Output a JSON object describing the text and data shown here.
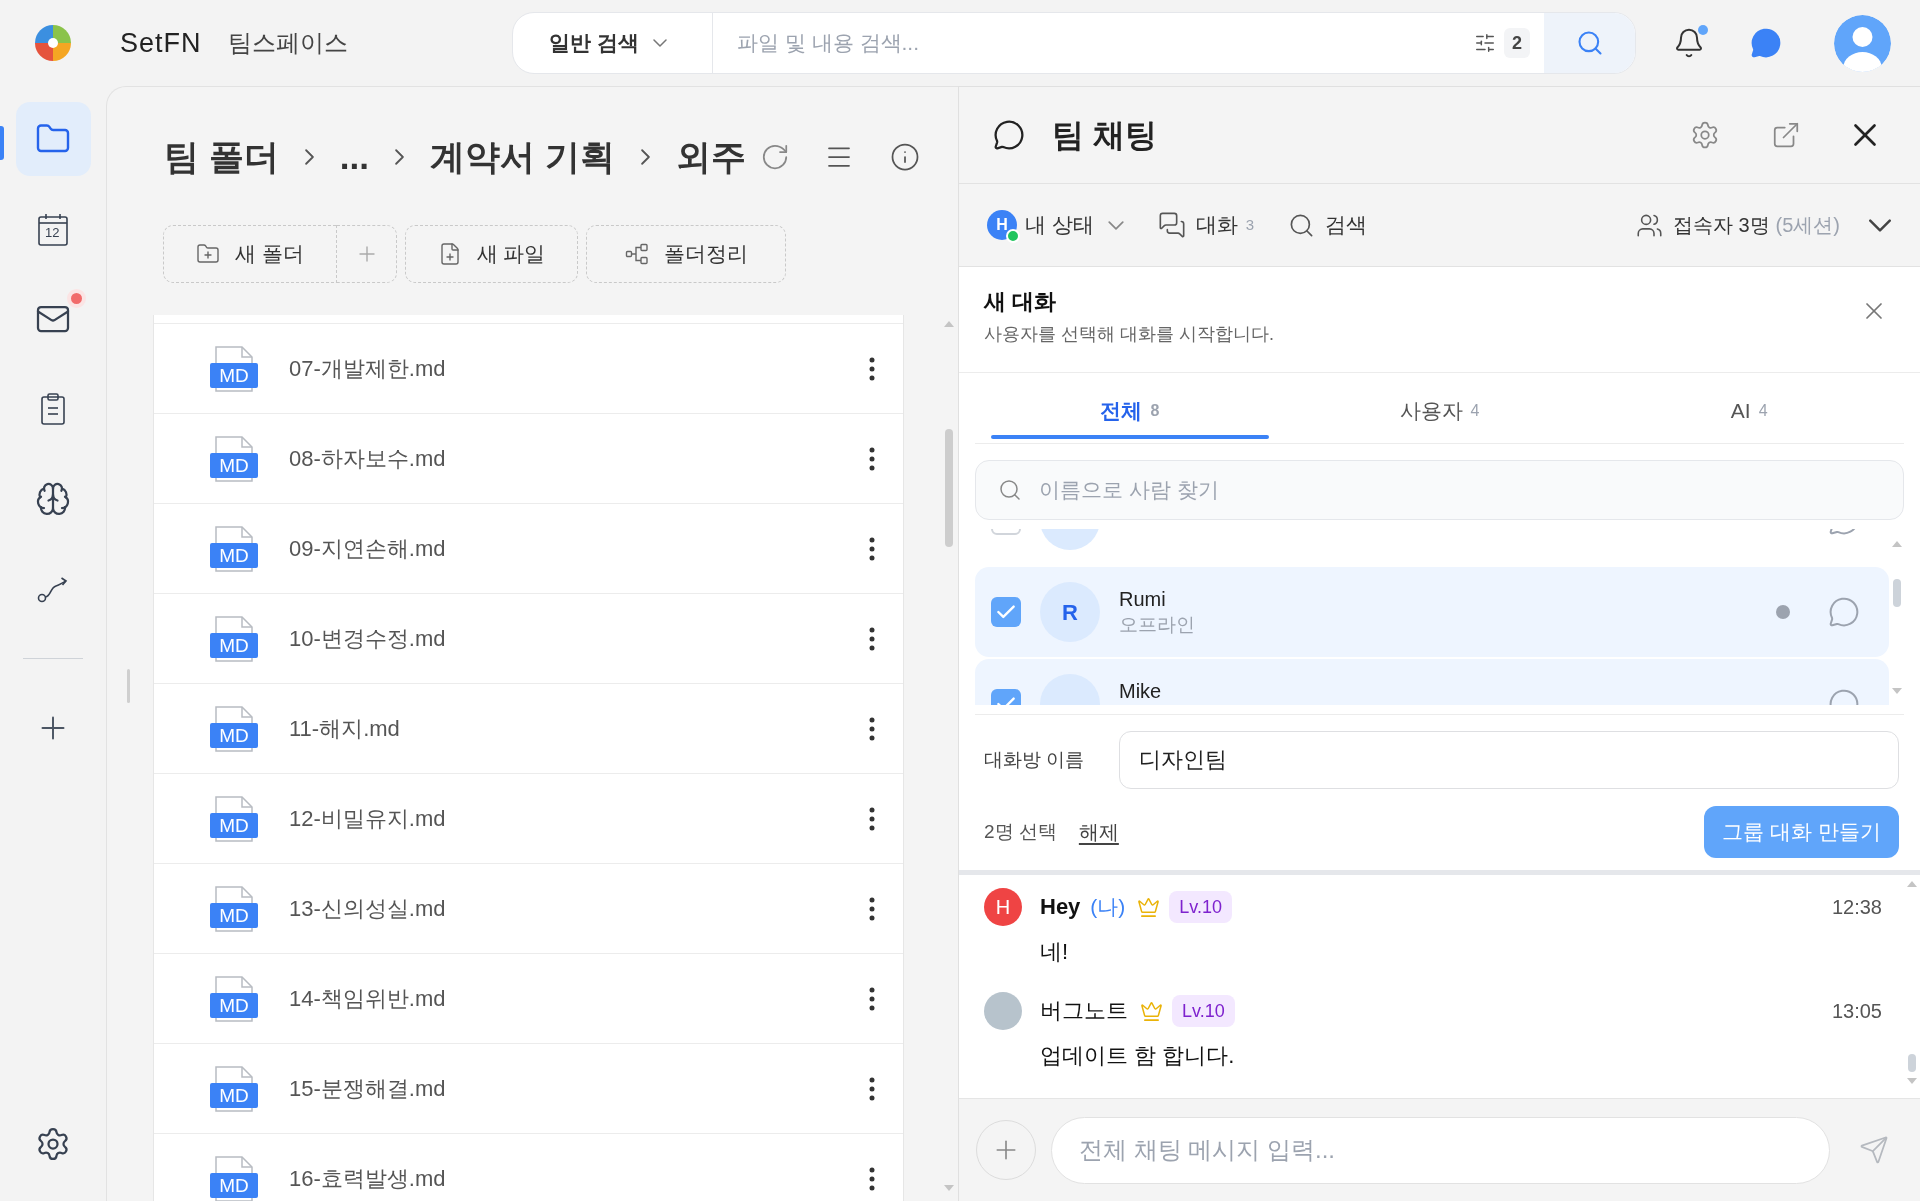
{
  "top_bar": {
    "brand": "SetFN",
    "workspace": "팀스페이스",
    "search": {
      "scope": "일반 검색",
      "placeholder": "파일 및 내용 검색...",
      "filter_count": "2"
    },
    "notifications": {
      "unread": true
    }
  },
  "sidebar": {
    "items": [
      {
        "kind": "folder",
        "selected": true,
        "alert": false
      },
      {
        "kind": "calendar",
        "date": "12",
        "selected": false,
        "alert": false
      },
      {
        "kind": "mail",
        "selected": false,
        "alert": true
      },
      {
        "kind": "clipboard",
        "selected": false,
        "alert": false
      },
      {
        "kind": "brain",
        "selected": false,
        "alert": false
      },
      {
        "kind": "route",
        "selected": false,
        "alert": false
      }
    ]
  },
  "breadcrumb": [
    "팀 폴더",
    "...",
    "계약서 기획",
    "외주"
  ],
  "toolbar": [
    {
      "kind": "new_folder",
      "label": "새 폴더"
    },
    {
      "kind": "new_file",
      "label": "새 파일"
    },
    {
      "kind": "organize",
      "label": "폴더정리"
    }
  ],
  "files": [
    {
      "name": "07-개발제한.md",
      "type": "MD"
    },
    {
      "name": "08-하자보수.md",
      "type": "MD"
    },
    {
      "name": "09-지연손해.md",
      "type": "MD"
    },
    {
      "name": "10-변경수정.md",
      "type": "MD"
    },
    {
      "name": "11-해지.md",
      "type": "MD"
    },
    {
      "name": "12-비밀유지.md",
      "type": "MD"
    },
    {
      "name": "13-신의성실.md",
      "type": "MD"
    },
    {
      "name": "14-책임위반.md",
      "type": "MD"
    },
    {
      "name": "15-분쟁해결.md",
      "type": "MD"
    },
    {
      "name": "16-효력발생.md",
      "type": "MD"
    }
  ],
  "chat": {
    "title": "팀 채팅",
    "my_status": {
      "initial": "H",
      "label": "내 상태",
      "online": true
    },
    "conversations": {
      "label": "대화",
      "count": "3"
    },
    "search": {
      "label": "검색"
    },
    "presence": {
      "label": "접속자 3명",
      "sessions": "(5세션)"
    },
    "new_chat": {
      "title": "새 대화",
      "subtitle": "사용자를 선택해 대화를 시작합니다.",
      "tabs": [
        {
          "label": "전체",
          "count": "8",
          "selected": true
        },
        {
          "label": "사용자",
          "count": "4",
          "selected": false
        },
        {
          "label": "AI",
          "count": "4",
          "selected": false
        }
      ],
      "search_placeholder": "이름으로 사람 찾기",
      "users": [
        {
          "checked": false
        },
        {
          "initial": "R",
          "name": "Rumi",
          "status": "오프라인",
          "online": false,
          "checked": true
        },
        {
          "name": "Mike",
          "checked": true
        }
      ],
      "room_name": {
        "label": "대화방 이름",
        "value": "디자인팀"
      },
      "selection": {
        "count": "2명 선택",
        "clear": "해제"
      },
      "create_button": "그룹 대화 만들기"
    },
    "messages": [
      {
        "author": "Hey",
        "me": true,
        "me_label": "(나)",
        "admin": true,
        "avatar": {
          "kind": "initial",
          "text": "H",
          "color": "#ef4444"
        },
        "rank": "Lv.10",
        "time": "12:38",
        "text": "네!"
      },
      {
        "author": "버그노트",
        "me": false,
        "admin": true,
        "avatar": {
          "kind": "photo"
        },
        "rank": "Lv.10",
        "time": "13:05",
        "text": "업데이트 함 합니다."
      }
    ],
    "composer": {
      "placeholder": "전체 채팅 메시지 입력..."
    }
  }
}
